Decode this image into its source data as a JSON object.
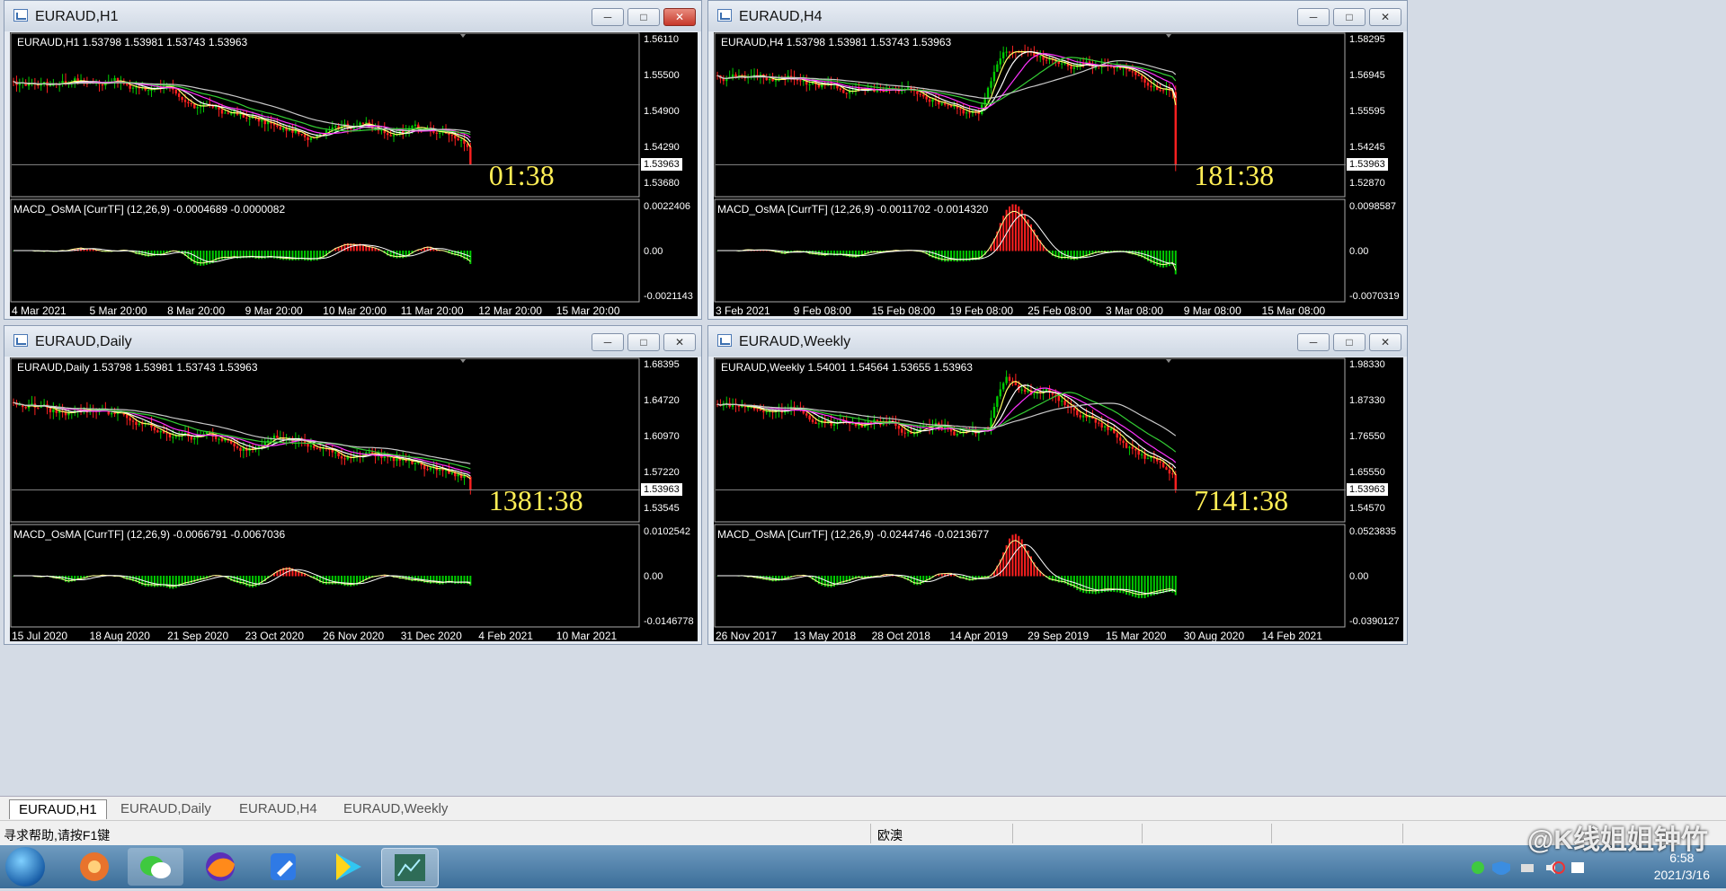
{
  "windows": [
    {
      "title": "EURAUD,H1",
      "active": true,
      "ohlc": "EURAUD,H1  1.53798 1.53981 1.53743 1.53963",
      "price_ticks": [
        "1.56110",
        "1.55500",
        "1.54900",
        "1.54290",
        "1.53680"
      ],
      "current_price": "1.53963",
      "timer": "01:38",
      "macd_label": "MACD_OsMA [CurrTF] (12,26,9) -0.0004689 -0.0000082",
      "macd_ticks": [
        "0.0022406",
        "0.00",
        "-0.0021143"
      ],
      "dates": [
        "4 Mar 2021",
        "5 Mar 20:00",
        "8 Mar 20:00",
        "9 Mar 20:00",
        "10 Mar 20:00",
        "11 Mar 20:00",
        "12 Mar 20:00",
        "15 Mar 20:00"
      ]
    },
    {
      "title": "EURAUD,H4",
      "active": false,
      "ohlc": "EURAUD,H4  1.53798 1.53981 1.53743 1.53963",
      "price_ticks": [
        "1.58295",
        "1.56945",
        "1.55595",
        "1.54245",
        "1.52870"
      ],
      "current_price": "1.53963",
      "timer": "181:38",
      "macd_label": "MACD_OsMA [CurrTF] (12,26,9) -0.0011702 -0.0014320",
      "macd_ticks": [
        "0.0098587",
        "0.00",
        "-0.0070319"
      ],
      "dates": [
        "3 Feb 2021",
        "9 Feb 08:00",
        "15 Feb 08:00",
        "19 Feb 08:00",
        "25 Feb 08:00",
        "3 Mar 08:00",
        "9 Mar 08:00",
        "15 Mar 08:00"
      ]
    },
    {
      "title": "EURAUD,Daily",
      "active": false,
      "ohlc": "EURAUD,Daily  1.53798 1.53981 1.53743 1.53963",
      "price_ticks": [
        "1.68395",
        "1.64720",
        "1.60970",
        "1.57220",
        "1.53545"
      ],
      "current_price": "1.53963",
      "timer": "1381:38",
      "macd_label": "MACD_OsMA [CurrTF] (12,26,9) -0.0066791 -0.0067036",
      "macd_ticks": [
        "0.0102542",
        "0.00",
        "-0.0146778"
      ],
      "dates": [
        "15 Jul 2020",
        "18 Aug 2020",
        "21 Sep 2020",
        "23 Oct 2020",
        "26 Nov 2020",
        "31 Dec 2020",
        "4 Feb 2021",
        "10 Mar 2021"
      ]
    },
    {
      "title": "EURAUD,Weekly",
      "active": false,
      "ohlc": "EURAUD,Weekly  1.54001 1.54564 1.53655 1.53963",
      "price_ticks": [
        "1.98330",
        "1.87330",
        "1.76550",
        "1.65550",
        "1.54570"
      ],
      "current_price": "1.53963",
      "timer": "7141:38",
      "macd_label": "MACD_OsMA [CurrTF] (12,26,9) -0.0244746 -0.0213677",
      "macd_ticks": [
        "0.0523835",
        "0.00",
        "-0.0390127"
      ],
      "dates": [
        "26 Nov 2017",
        "13 May 2018",
        "28 Oct 2018",
        "14 Apr 2019",
        "29 Sep 2019",
        "15 Mar 2020",
        "30 Aug 2020",
        "14 Feb 2021"
      ]
    }
  ],
  "tabs": [
    "EURAUD,H1",
    "EURAUD,Daily",
    "EURAUD,H4",
    "EURAUD,Weekly"
  ],
  "status": {
    "help": "寻求帮助,请按F1键",
    "symbol": "欧澳"
  },
  "clock": {
    "time": "6:58",
    "date": "2021/3/16"
  },
  "watermark": "@K线姐姐钟竹",
  "colors": {
    "bull": "#00cc00",
    "bear": "#ff2020",
    "ma_yellow": "#ffff66",
    "ma_white": "#ffffff",
    "ma_magenta": "#ff33ff",
    "ma_green": "#33cc33",
    "ma_gray": "#c8c8c8",
    "timer": "#ffee55"
  },
  "icons": [
    "window-icon",
    "minimize-icon",
    "maximize-icon",
    "close-icon",
    "start-orb-icon",
    "firefox-icon",
    "wechat-icon",
    "network-icon",
    "volume-icon",
    "flag-icon"
  ]
}
